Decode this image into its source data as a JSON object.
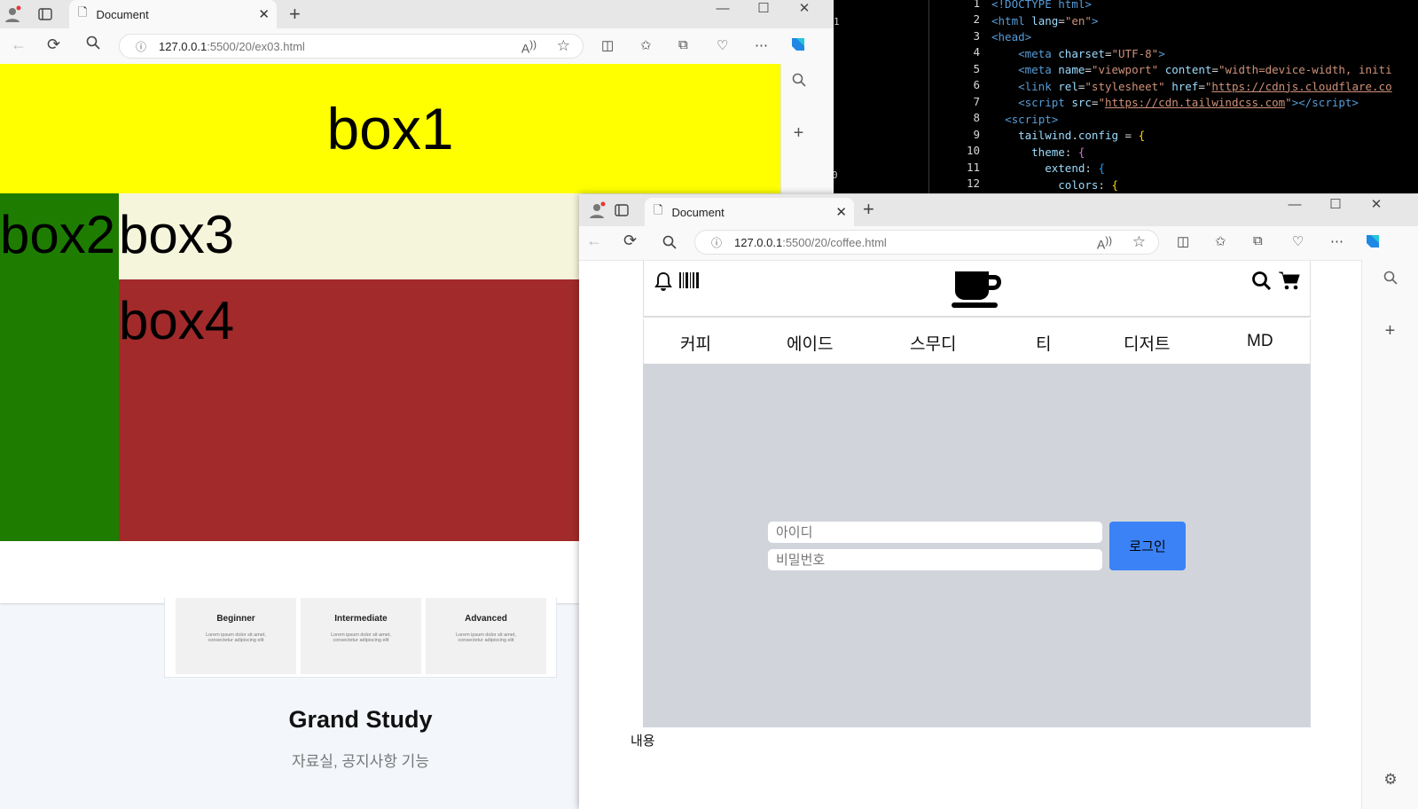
{
  "back_window": {
    "tab_title": "Document",
    "url_host": "127.0.0.1",
    "url_rest": ":5500/20/ex03.html",
    "boxes": [
      "box1",
      "box2",
      "box3",
      "box4"
    ],
    "colors": {
      "box1": "#ffff00",
      "box2": "#1e7d00",
      "box3": "#f5f5dc",
      "box4": "#a22a2a"
    },
    "study": {
      "levels": [
        "Beginner",
        "Intermediate",
        "Advanced"
      ],
      "level_text": [
        "Lorem ipsum dolor sit amet,",
        "consectetur adipiscing elit"
      ],
      "title": "Grand Study",
      "subtitle": "자료실, 공지사항 기능"
    }
  },
  "editor": {
    "stray_numbers": [
      "1",
      "0"
    ],
    "lines": [
      "1",
      "2",
      "3",
      "4",
      "5",
      "6",
      "7",
      "8",
      "9",
      "10",
      "11",
      "12"
    ]
  },
  "front_window": {
    "tab_title": "Document",
    "url_host": "127.0.0.1",
    "url_rest": ":5500/20/coffee.html",
    "nav": [
      "커피",
      "에이드",
      "스무디",
      "티",
      "디저트",
      "MD"
    ],
    "id_placeholder": "아이디",
    "pw_placeholder": "비밀번호",
    "login_label": "로그인",
    "content_label": "내용",
    "accent": "#3b82f6",
    "hero_bg": "#d1d5db"
  },
  "icons": [
    "profile-icon",
    "tabs-icon",
    "doc-icon",
    "close-icon",
    "plus-icon",
    "minimize-icon",
    "maximize-icon",
    "back-icon",
    "refresh-icon",
    "search-icon",
    "info-icon",
    "read-aloud-icon",
    "star-icon",
    "split-icon",
    "favorites-icon",
    "collections-icon",
    "health-icon",
    "more-icon",
    "copilot-icon",
    "bell-icon",
    "barcode-icon",
    "coffee-cup-icon",
    "cart-icon",
    "settings-icon"
  ]
}
